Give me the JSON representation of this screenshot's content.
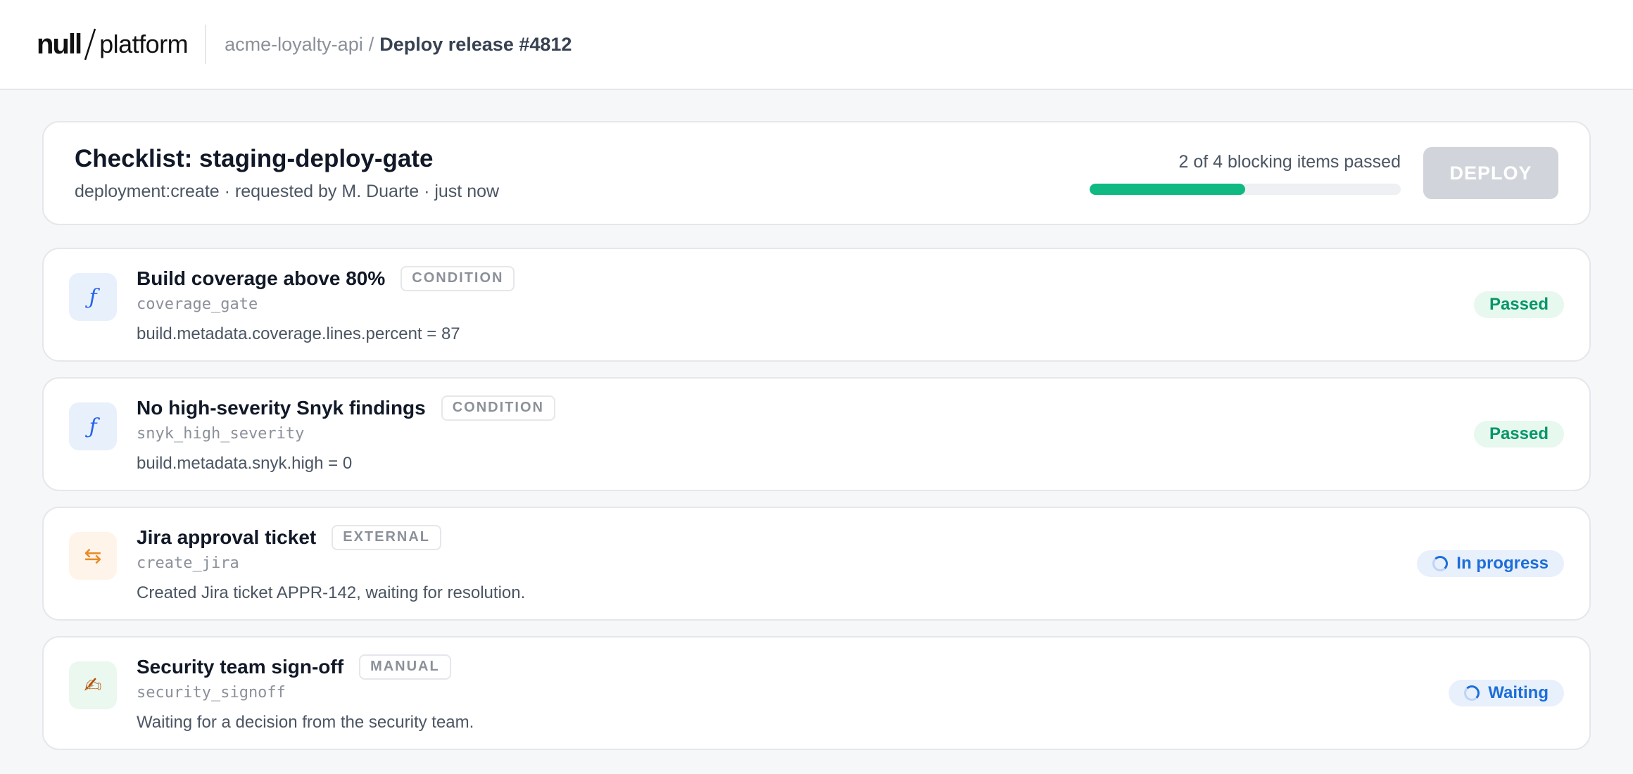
{
  "brand": {
    "logo_null": "null",
    "logo_platform": "platform"
  },
  "breadcrumb": {
    "app": "acme-loyalty-api",
    "separator": "/",
    "current": "Deploy release #4812"
  },
  "checklist": {
    "title": "Checklist: staging-deploy-gate",
    "subtitle": "deployment:create · requested by M. Duarte · just now",
    "progress_text": "2 of 4 blocking items passed",
    "progress_passed": 2,
    "progress_total": 4,
    "deploy_label": "DEPLOY"
  },
  "items": [
    {
      "title": "Build coverage above 80%",
      "type": "CONDITION",
      "key": "coverage_gate",
      "description": "build.metadata.coverage.lines.percent = 87",
      "status": "Passed",
      "icon": "function-icon",
      "icon_glyph": "ƒ"
    },
    {
      "title": "No high-severity Snyk findings",
      "type": "CONDITION",
      "key": "snyk_high_severity",
      "description": "build.metadata.snyk.high = 0",
      "status": "Passed",
      "icon": "function-icon",
      "icon_glyph": "ƒ"
    },
    {
      "title": "Jira approval ticket",
      "type": "EXTERNAL",
      "key": "create_jira",
      "description": "Created Jira ticket APPR-142, waiting for resolution.",
      "status": "In progress",
      "icon": "swap-arrows-icon",
      "icon_glyph": "⇆"
    },
    {
      "title": "Security team sign-off",
      "type": "MANUAL",
      "key": "security_signoff",
      "description": "Waiting for a decision from the security team.",
      "status": "Waiting",
      "icon": "writing-hand-icon",
      "icon_glyph": "✍"
    }
  ],
  "colors": {
    "passed": "#059669",
    "pending": "#1d6ed8",
    "progress_fill": "#10b981",
    "deploy_disabled": "#d1d5db"
  }
}
